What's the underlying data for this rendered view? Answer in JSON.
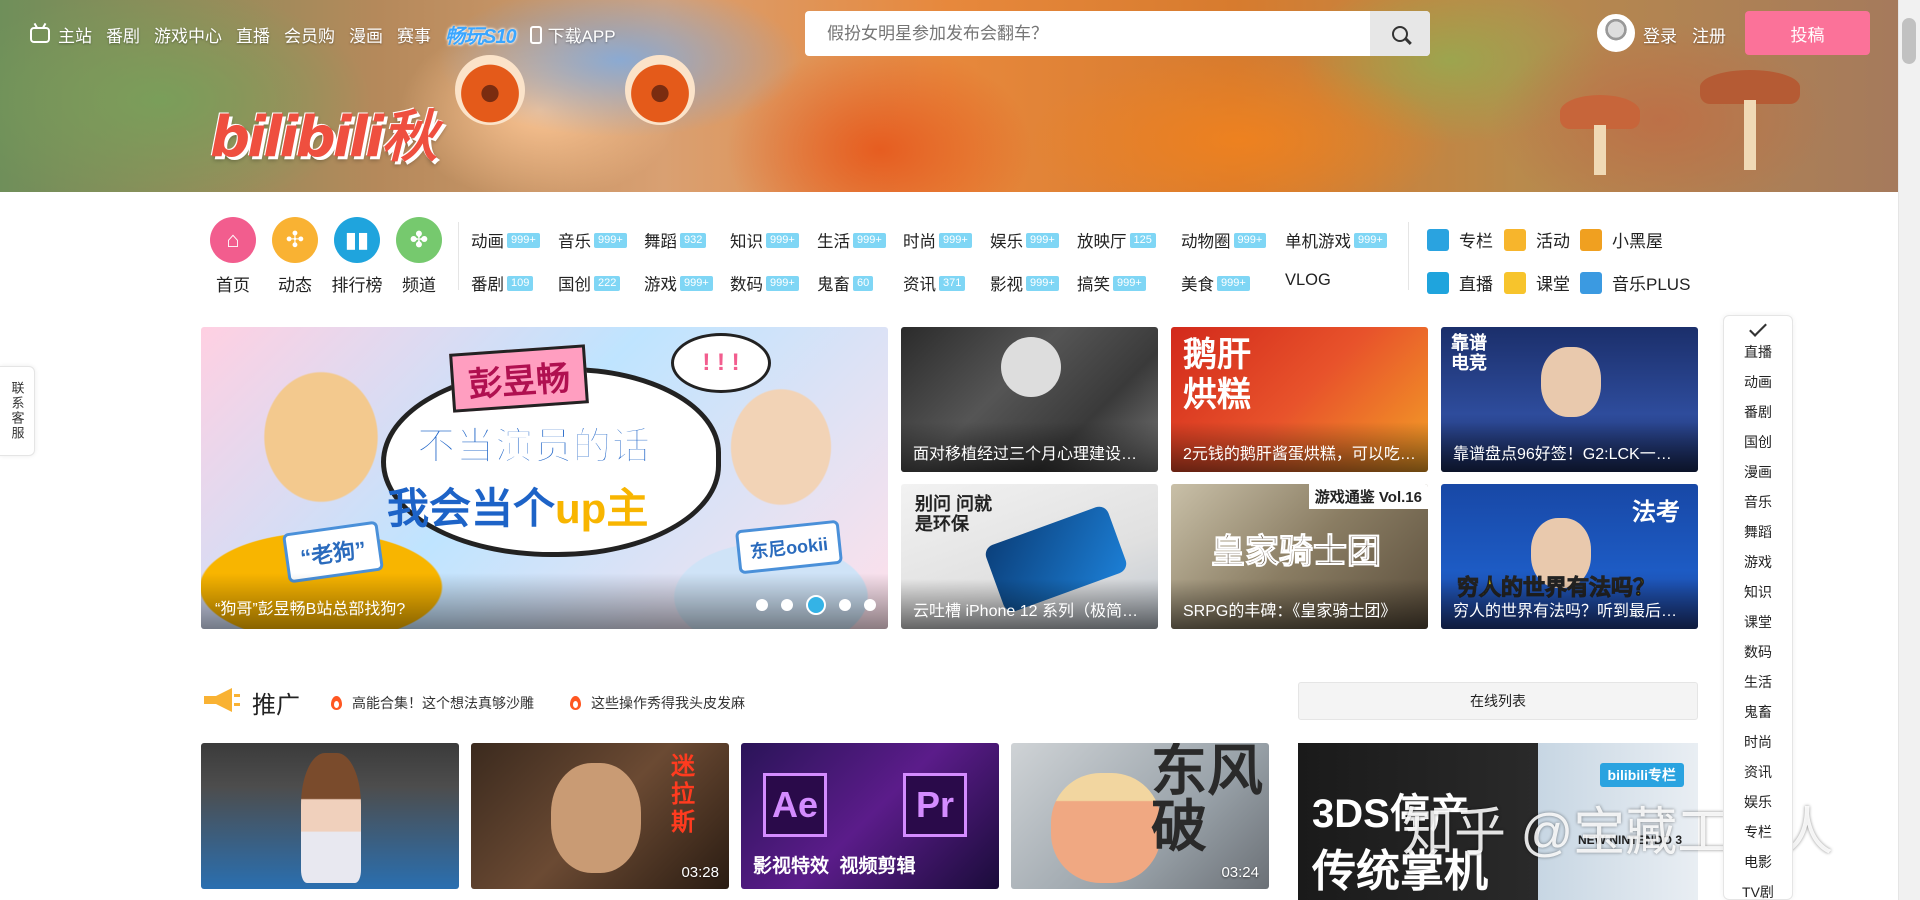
{
  "topnav": {
    "items": [
      "主站",
      "番剧",
      "游戏中心",
      "直播",
      "会员购",
      "漫画",
      "赛事"
    ],
    "promo": "畅玩S10",
    "download": "下载APP"
  },
  "search": {
    "placeholder": "假扮女明星参加发布会翻车？"
  },
  "user": {
    "login": "登录",
    "register": "注册",
    "upload": "投稿"
  },
  "logo": {
    "text": "bilibili秋"
  },
  "main_icons": [
    {
      "label": "首页",
      "icon": "home-icon",
      "color": "#f25d8e"
    },
    {
      "label": "动态",
      "icon": "windmill-icon",
      "color": "#f9b233"
    },
    {
      "label": "排行榜",
      "icon": "ranking-icon",
      "color": "#1fa4dd"
    },
    {
      "label": "频道",
      "icon": "channel-icon",
      "color": "#76c96e"
    }
  ],
  "categories_row1": [
    {
      "label": "动画",
      "badge": "999+"
    },
    {
      "label": "音乐",
      "badge": "999+"
    },
    {
      "label": "舞蹈",
      "badge": "932"
    },
    {
      "label": "知识",
      "badge": "999+"
    },
    {
      "label": "生活",
      "badge": "999+"
    },
    {
      "label": "时尚",
      "badge": "999+"
    },
    {
      "label": "娱乐",
      "badge": "999+"
    },
    {
      "label": "放映厅",
      "badge": "125"
    },
    {
      "label": "动物圈",
      "badge": "999+"
    },
    {
      "label": "单机游戏",
      "badge": "999+"
    }
  ],
  "categories_row2": [
    {
      "label": "番剧",
      "badge": "109"
    },
    {
      "label": "国创",
      "badge": "222"
    },
    {
      "label": "游戏",
      "badge": "999+"
    },
    {
      "label": "数码",
      "badge": "999+"
    },
    {
      "label": "鬼畜",
      "badge": "60"
    },
    {
      "label": "资讯",
      "badge": "371"
    },
    {
      "label": "影视",
      "badge": "999+"
    },
    {
      "label": "搞笑",
      "badge": "999+"
    },
    {
      "label": "美食",
      "badge": "999+"
    },
    {
      "label": "VLOG",
      "badge": ""
    }
  ],
  "side_links": [
    {
      "label": "专栏",
      "color": "#2aa3e0"
    },
    {
      "label": "活动",
      "color": "#f7b52c"
    },
    {
      "label": "小黑屋",
      "color": "#f0a020"
    },
    {
      "label": "直播",
      "color": "#1fa4dd"
    },
    {
      "label": "课堂",
      "color": "#f7c42c"
    },
    {
      "label": "音乐PLUS",
      "color": "#3b9ae1"
    }
  ],
  "carousel": {
    "name_tag": "彭昱畅",
    "exclaim": "! ! !",
    "slogan_line1": "不当演员的话",
    "slogan_line2_a": "我会当个",
    "slogan_line2_up": "up主",
    "tag_left": "“老狗”",
    "tag_right": "东尼ookii",
    "caption": "“狗哥”彭昱畅B站总部找狗?",
    "slide_count": 5,
    "active_slide": 3
  },
  "tiles": [
    {
      "title": "面对移植经过三个月心理建设后，",
      "overlay": ""
    },
    {
      "title": "2元钱的鹅肝酱蛋烘糕，可以吃吗？",
      "overlay": "鹅肝烘糕"
    },
    {
      "title": "靠谱盘点96好签！G2:LCK一号种子",
      "overlay": "靠谱电竞"
    },
    {
      "title": "云吐槽 iPhone 12 系列（极简版）",
      "overlay": "别问 问就是环保"
    },
    {
      "title": "SRPG的丰碑：《皇家骑士团》",
      "overlay": "皇家骑士团",
      "badge": "游戏通鉴 Vol.16"
    },
    {
      "title": "穷人的世界有法吗？听到最后我泪目了",
      "overlay": "穷人的世界有法吗？",
      "badge": "法考"
    }
  ],
  "promo": {
    "title": "推广",
    "hot1": "高能合集！这个想法真够沙雕",
    "hot2": "这些操作秀得我头皮发麻",
    "online_list": "在线列表"
  },
  "videos": [
    {
      "duration": "",
      "overlay": ""
    },
    {
      "duration": "03:28",
      "overlay": "迷拉斯"
    },
    {
      "duration": "",
      "overlay": "影视特效  视频剪辑",
      "ae": "Ae",
      "pr": "Pr"
    },
    {
      "duration": "03:24",
      "overlay": "东风破"
    }
  ],
  "right_feature": {
    "brand": "bilibili专栏",
    "line1": "3DS停产",
    "line2": "传统掌机",
    "console": "NEW NINTENDO 3"
  },
  "watermark": "知乎 @宝藏工具人",
  "customer_service": "联系客服",
  "sidebar_items": [
    "直播",
    "动画",
    "番剧",
    "国创",
    "漫画",
    "音乐",
    "舞蹈",
    "游戏",
    "知识",
    "课堂",
    "数码",
    "生活",
    "鬼畜",
    "时尚",
    "资讯",
    "娱乐",
    "专栏",
    "电影",
    "TV剧"
  ]
}
